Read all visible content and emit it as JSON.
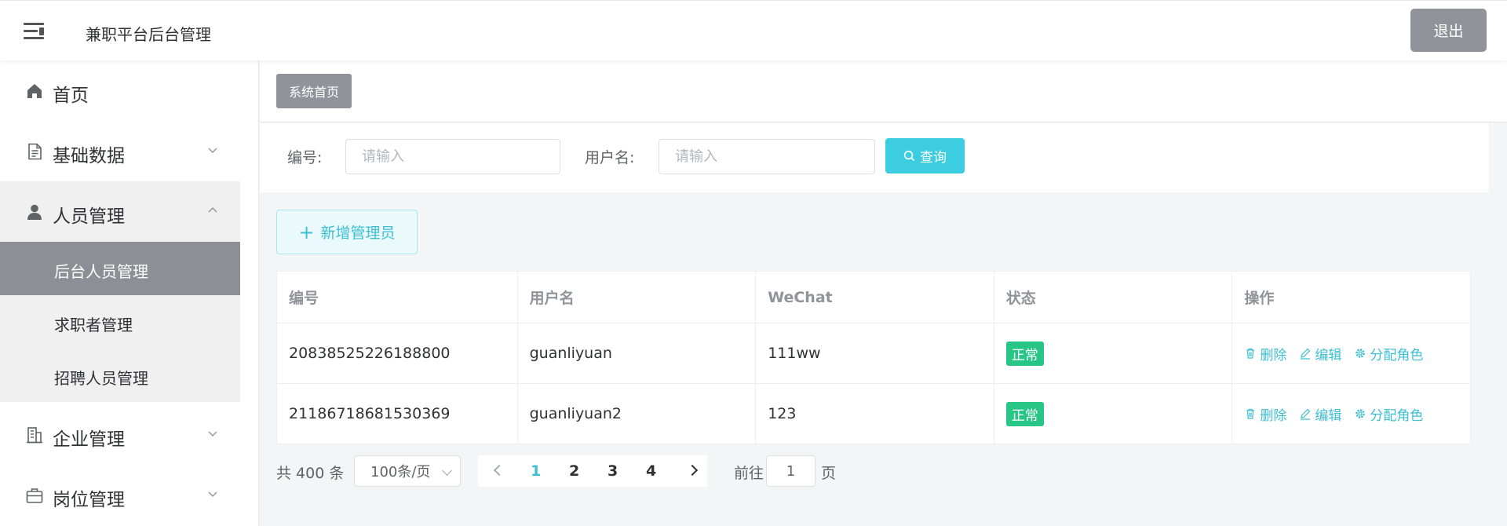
{
  "header": {
    "title": "兼职平台后台管理",
    "logout_label": "退出"
  },
  "sidebar": {
    "items": [
      {
        "label": "首页",
        "icon": "home-icon"
      },
      {
        "label": "基础数据",
        "icon": "document-icon",
        "expandable": true
      },
      {
        "label": "人员管理",
        "icon": "user-icon",
        "expandable": true,
        "expanded": true
      },
      {
        "label": "企业管理",
        "icon": "building-icon",
        "expandable": true
      },
      {
        "label": "岗位管理",
        "icon": "briefcase-icon",
        "expandable": true
      }
    ],
    "submenu": [
      {
        "label": "后台人员管理",
        "active": true
      },
      {
        "label": "求职者管理"
      },
      {
        "label": "招聘人员管理"
      }
    ]
  },
  "tags": {
    "current": "系统首页"
  },
  "filters": {
    "id_label": "编号:",
    "id_placeholder": "请输入",
    "username_label": "用户名:",
    "username_placeholder": "请输入",
    "query_label": "查询"
  },
  "actions": {
    "add_label": "新增管理员"
  },
  "table": {
    "columns": [
      "编号",
      "用户名",
      "WeChat",
      "状态",
      "操作"
    ],
    "rows": [
      {
        "id": "20838525226188800",
        "username": "guanliyuan",
        "wechat": "111ww",
        "status": "正常"
      },
      {
        "id": "21186718681530369",
        "username": "guanliyuan2",
        "wechat": "123",
        "status": "正常"
      }
    ],
    "ops": {
      "delete": "删除",
      "edit": "编辑",
      "assign_role": "分配角色"
    }
  },
  "pagination": {
    "total_text": "共 400 条",
    "page_size": "100条/页",
    "pages": [
      "1",
      "2",
      "3",
      "4"
    ],
    "current_page": "1",
    "goto_prefix": "前往",
    "goto_value": "1",
    "goto_suffix": "页"
  },
  "colors": {
    "accent": "#3cbfd3",
    "query_button": "#3ccde0",
    "status_ok": "#27c686",
    "active_menu_bg": "#8c8f95",
    "logout_bg": "#909399"
  }
}
